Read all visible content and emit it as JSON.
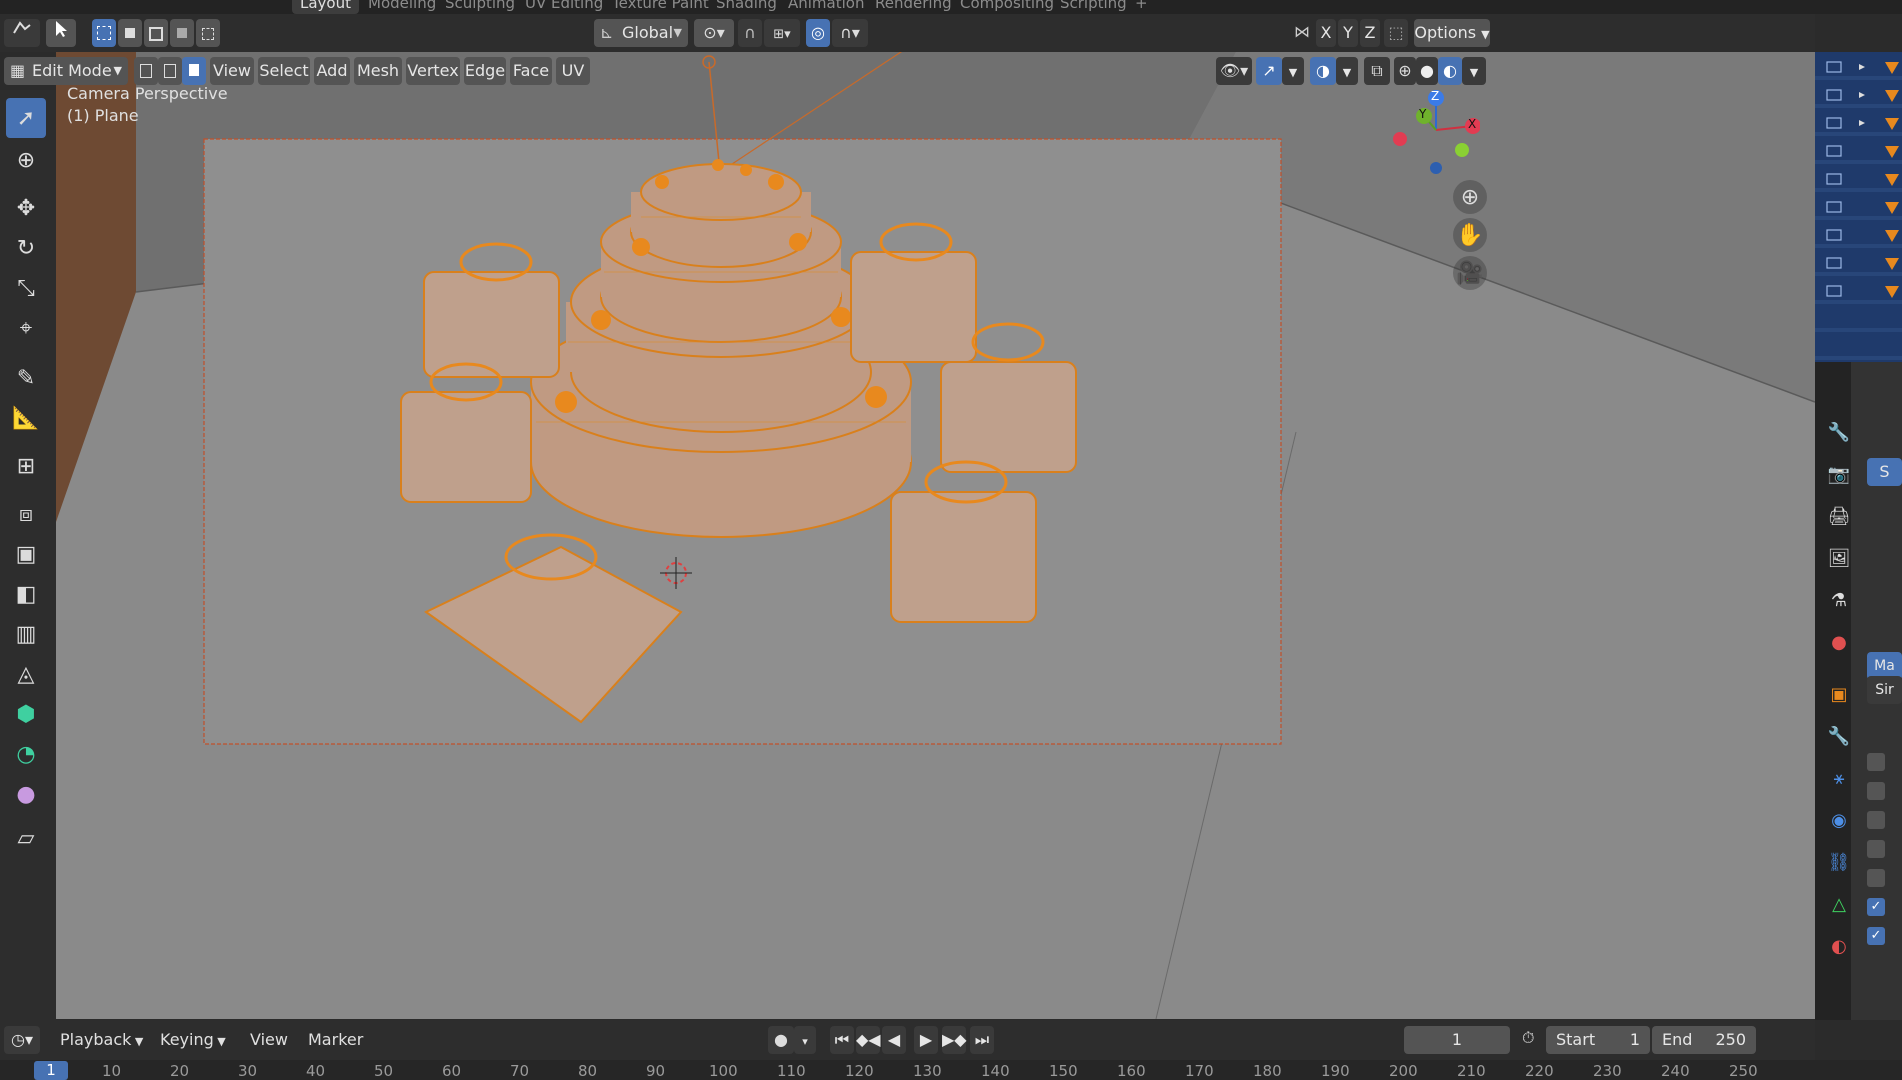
{
  "top_tabs": [
    "Layout",
    "Modeling",
    "Sculpting",
    "UV Editing",
    "Texture Paint",
    "Shading",
    "Animation",
    "Rendering",
    "Compositing",
    "Scripting",
    "+"
  ],
  "header1": {
    "transform_orientation": "Global",
    "options_label": "Options",
    "axis_x": "X",
    "axis_y": "Y",
    "axis_z": "Z"
  },
  "header2": {
    "mode": "Edit Mode",
    "menus": [
      "View",
      "Select",
      "Add",
      "Mesh",
      "Vertex",
      "Edge",
      "Face",
      "UV"
    ]
  },
  "viewport": {
    "perspective_label": "Camera Perspective",
    "object_label": "(1) Plane",
    "gizmo": {
      "x": "X",
      "y": "Y",
      "z": "Z"
    }
  },
  "timeline": {
    "menus": [
      "Playback",
      "Keying",
      "View",
      "Marker"
    ],
    "current_frame": "1",
    "start_label": "Start",
    "start_value": "1",
    "end_label": "End",
    "end_value": "250"
  },
  "ruler": {
    "current": "1",
    "ticks": [
      "10",
      "20",
      "30",
      "40",
      "50",
      "60",
      "70",
      "80",
      "90",
      "100",
      "110",
      "120",
      "130",
      "140",
      "150",
      "160",
      "170",
      "180",
      "190",
      "200",
      "210",
      "220",
      "230",
      "240",
      "250"
    ]
  },
  "props_panel": {
    "s_button": "S",
    "ma_button": "Ma",
    "si_button": "Sir"
  },
  "colors": {
    "accent_blue": "#4772b3",
    "selection_orange": "#e8891e",
    "viewport_bg": "#858585"
  }
}
